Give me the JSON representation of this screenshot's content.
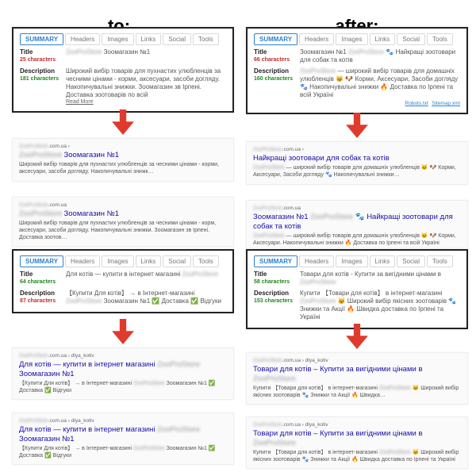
{
  "labels": {
    "to": "to:",
    "after": "after:"
  },
  "tabs": [
    "SUMMARY",
    "Headers",
    "Images",
    "Links",
    "Social",
    "Tools"
  ],
  "rowlabels": {
    "title": "Title",
    "desc": "Description",
    "chars_suffix": " characters"
  },
  "readmore": "Read More",
  "blurWord": "ZooProStore",
  "crumbBase": ".com.ua",
  "footerLinks": [
    "Robots.txt",
    "Sitemap.xml"
  ],
  "left": {
    "card1": {
      "title_chars": "25",
      "title_chars_class": "bad",
      "title_val": " Зоомагазин №1",
      "desc_chars": "181",
      "desc_chars_class": "good",
      "desc_val": "Широкий вибір товарів для пухнастих улюбленців за чесними цінами - корми, аксесуари, засоби догляду. Накопичувальні знижки. Зоомагазин зв Ірпені. Доставка зоотоварів по всій"
    },
    "serp1": {
      "crumb": "",
      "title": " Зоомагазин №1",
      "desc": "Широкий вибір товарів для пухнастих улюбленців за чесними цінами - корми, аксесуари, засоби догляду. Накопичувальні знижк…"
    },
    "serp2": {
      "title": " Зоомагазин №1",
      "desc": "Широкий вибір товарів для пухнастих улюбленців за чесними цінами - корм, аксесуари, засоби догляду. Накопичувальні знижки. Зоомагазин зв Ірпені. Доставка зоотов…"
    },
    "card2": {
      "title_chars": "64",
      "title_chars_class": "good",
      "title_val": "Для котів — купити в інтернет магазині ",
      "desc_chars": "87",
      "desc_chars_class": "bad",
      "desc_val": "【Купити Для котів】 → в Інтернет-магазині ",
      "desc_val2": " Зоомагазин №1 ✅ Доставка ✅ Відгуки"
    },
    "serp3": {
      "crumb": " › dlya_kotiv",
      "title": "Для котів — купити в інтернет магазині ",
      "title2": " Зоомагазин №1",
      "desc": "【Купити Для котів】 → в Інтернет-магазині ",
      "desc2": " Зоомагазин №1 ✅ Доставка ✅ Відгуки"
    },
    "serp4": {
      "title": "Для котів — купити в інтернет магазині ",
      "title2": " Зоомагазин №1",
      "desc": "【Купити Для котів】 → в Інтернет-магазині ",
      "desc2": " Зоомагазин №1 ✅ Доставка ✅ Відгуки"
    }
  },
  "right": {
    "card1": {
      "title_chars": "66",
      "title_chars_class": "bad",
      "title_val_pre": "Зоомагазин №1 ",
      "title_val_post": " 🐾 Найкращі зоотовари для собак та котів",
      "desc_chars": "160",
      "desc_chars_class": "good",
      "desc_val_pre": "",
      "desc_val_post": " — широкий вибір товарів для домашніх улюбленців 🐱 🐶 Корми, Аксесуари, Засоби догляду 🐾 Накопичувальні знижки 🔥 Доставка по Ірпені та всій Україні"
    },
    "serp1": {
      "title": "Найкращі зоотовари для собак та котів",
      "desc_pre": "",
      "desc_post": " — широкий вибір товарів для домашніх улюбленців 🐱 🐶 Корми, Аксесуари, Засоби догляду 🐾 Накопичувальні знижки…"
    },
    "serp2": {
      "title_pre": "Зоомагазин №1 ",
      "title_post": " 🐾 Найкращі зоотовари для собак та котів",
      "desc_post": " — широкий вибір товарів для домашніх улюбленців 🐱 🐶 Корми, Аксесуари. Накопичувальні знижки 🔥 Доставка по Ірпені та всій Україні"
    },
    "card2": {
      "title_chars": "58",
      "title_chars_class": "good",
      "title_val": "Товари для котів - Купити за вигідними цінами в ",
      "desc_chars": "153",
      "desc_chars_class": "good",
      "desc_val": "Купити 【Товари для котів】 в інтернет-магазині ",
      "desc_val2": " 🐱 Широкий вибір якісних зоотоварів 🐾 Знижки та Акції 🔥 Швидка доставка по Ірпені та Україні"
    },
    "serp3": {
      "crumb": " › dlya_kotiv",
      "title": "Товари для котів – Купити за вигідними цінами в ",
      "desc": "Купити 【Товари для котів】 в інтернет-магазині ",
      "desc2": " 🐱 Широкий вибір якісних зоотоварів 🐾 Знижки та Акції 🔥 Швидка…"
    },
    "serp4": {
      "title": "Товари для котів – Купити за вигідними цінами в ",
      "desc": "Купити 【Товари для котів】 в інтернет-магазині ",
      "desc2": " 🐱 Широкий вибір якісних зоотоварів 🐾 Знижки та Акції 🔥 Швидка доставка по Ірпені та Україні"
    }
  }
}
